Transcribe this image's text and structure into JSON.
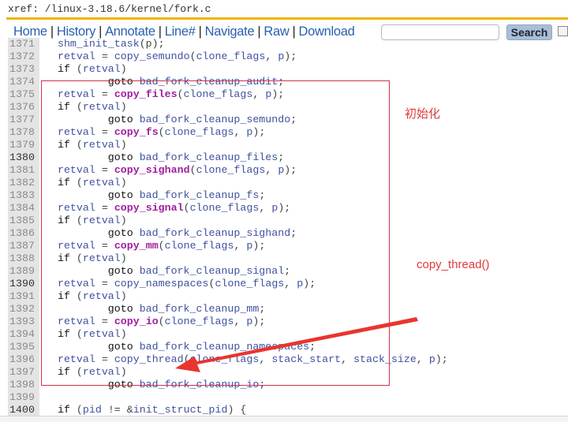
{
  "header": {
    "xref": "xref: /linux-3.18.6/kernel/fork.c"
  },
  "nav": {
    "items": [
      "Home",
      "History",
      "Annotate",
      "Line#",
      "Navigate",
      "Raw",
      "Download"
    ],
    "separator": "|",
    "search_value": "",
    "search_button": "Search"
  },
  "colors": {
    "accent": "#f0b400",
    "identifier": "#3f51a0",
    "function": "#a01fa0",
    "annotation": "#e03a3a"
  },
  "annotations": {
    "init_label": "初始化",
    "thread_label": "copy_thread()"
  },
  "code": [
    {
      "n": "1371",
      "p": [
        [
          "pn",
          "  "
        ],
        [
          "id",
          "shm_init_task"
        ],
        [
          "pn",
          "(p);"
        ]
      ]
    },
    {
      "n": "1372",
      "p": [
        [
          "pn",
          "  "
        ],
        [
          "id",
          "retval"
        ],
        [
          "pn",
          " = "
        ],
        [
          "id",
          "copy_semundo"
        ],
        [
          "pn",
          "("
        ],
        [
          "id",
          "clone_flags"
        ],
        [
          "pn",
          ", "
        ],
        [
          "id",
          "p"
        ],
        [
          "pn",
          ");"
        ]
      ]
    },
    {
      "n": "1373",
      "p": [
        [
          "kw",
          "  if "
        ],
        [
          "pn",
          "("
        ],
        [
          "id",
          "retval"
        ],
        [
          "pn",
          ")"
        ]
      ]
    },
    {
      "n": "1374",
      "p": [
        [
          "kw",
          "          goto "
        ],
        [
          "id",
          "bad_fork_cleanup_audit"
        ],
        [
          "pn",
          ";"
        ]
      ]
    },
    {
      "n": "1375",
      "p": [
        [
          "pn",
          "  "
        ],
        [
          "id",
          "retval"
        ],
        [
          "pn",
          " = "
        ],
        [
          "fn",
          "copy_files"
        ],
        [
          "pn",
          "("
        ],
        [
          "id",
          "clone_flags"
        ],
        [
          "pn",
          ", "
        ],
        [
          "id",
          "p"
        ],
        [
          "pn",
          ");"
        ]
      ]
    },
    {
      "n": "1376",
      "p": [
        [
          "kw",
          "  if "
        ],
        [
          "pn",
          "("
        ],
        [
          "id",
          "retval"
        ],
        [
          "pn",
          ")"
        ]
      ]
    },
    {
      "n": "1377",
      "p": [
        [
          "kw",
          "          goto "
        ],
        [
          "id",
          "bad_fork_cleanup_semundo"
        ],
        [
          "pn",
          ";"
        ]
      ]
    },
    {
      "n": "1378",
      "p": [
        [
          "pn",
          "  "
        ],
        [
          "id",
          "retval"
        ],
        [
          "pn",
          " = "
        ],
        [
          "fn",
          "copy_fs"
        ],
        [
          "pn",
          "("
        ],
        [
          "id",
          "clone_flags"
        ],
        [
          "pn",
          ", "
        ],
        [
          "id",
          "p"
        ],
        [
          "pn",
          ");"
        ]
      ]
    },
    {
      "n": "1379",
      "p": [
        [
          "kw",
          "  if "
        ],
        [
          "pn",
          "("
        ],
        [
          "id",
          "retval"
        ],
        [
          "pn",
          ")"
        ]
      ]
    },
    {
      "n": "1380",
      "p": [
        [
          "kw",
          "          goto "
        ],
        [
          "id",
          "bad_fork_cleanup_files"
        ],
        [
          "pn",
          ";"
        ]
      ]
    },
    {
      "n": "1381",
      "p": [
        [
          "pn",
          "  "
        ],
        [
          "id",
          "retval"
        ],
        [
          "pn",
          " = "
        ],
        [
          "fn",
          "copy_sighand"
        ],
        [
          "pn",
          "("
        ],
        [
          "id",
          "clone_flags"
        ],
        [
          "pn",
          ", "
        ],
        [
          "id",
          "p"
        ],
        [
          "pn",
          ");"
        ]
      ]
    },
    {
      "n": "1382",
      "p": [
        [
          "kw",
          "  if "
        ],
        [
          "pn",
          "("
        ],
        [
          "id",
          "retval"
        ],
        [
          "pn",
          ")"
        ]
      ]
    },
    {
      "n": "1383",
      "p": [
        [
          "kw",
          "          goto "
        ],
        [
          "id",
          "bad_fork_cleanup_fs"
        ],
        [
          "pn",
          ";"
        ]
      ]
    },
    {
      "n": "1384",
      "p": [
        [
          "pn",
          "  "
        ],
        [
          "id",
          "retval"
        ],
        [
          "pn",
          " = "
        ],
        [
          "fn",
          "copy_signal"
        ],
        [
          "pn",
          "("
        ],
        [
          "id",
          "clone_flags"
        ],
        [
          "pn",
          ", "
        ],
        [
          "id",
          "p"
        ],
        [
          "pn",
          ");"
        ]
      ]
    },
    {
      "n": "1385",
      "p": [
        [
          "kw",
          "  if "
        ],
        [
          "pn",
          "("
        ],
        [
          "id",
          "retval"
        ],
        [
          "pn",
          ")"
        ]
      ]
    },
    {
      "n": "1386",
      "p": [
        [
          "kw",
          "          goto "
        ],
        [
          "id",
          "bad_fork_cleanup_sighand"
        ],
        [
          "pn",
          ";"
        ]
      ]
    },
    {
      "n": "1387",
      "p": [
        [
          "pn",
          "  "
        ],
        [
          "id",
          "retval"
        ],
        [
          "pn",
          " = "
        ],
        [
          "fn",
          "copy_mm"
        ],
        [
          "pn",
          "("
        ],
        [
          "id",
          "clone_flags"
        ],
        [
          "pn",
          ", "
        ],
        [
          "id",
          "p"
        ],
        [
          "pn",
          ");"
        ]
      ]
    },
    {
      "n": "1388",
      "p": [
        [
          "kw",
          "  if "
        ],
        [
          "pn",
          "("
        ],
        [
          "id",
          "retval"
        ],
        [
          "pn",
          ")"
        ]
      ]
    },
    {
      "n": "1389",
      "p": [
        [
          "kw",
          "          goto "
        ],
        [
          "id",
          "bad_fork_cleanup_signal"
        ],
        [
          "pn",
          ";"
        ]
      ]
    },
    {
      "n": "1390",
      "p": [
        [
          "pn",
          "  "
        ],
        [
          "id",
          "retval"
        ],
        [
          "pn",
          " = "
        ],
        [
          "id",
          "copy_namespaces"
        ],
        [
          "pn",
          "("
        ],
        [
          "id",
          "clone_flags"
        ],
        [
          "pn",
          ", "
        ],
        [
          "id",
          "p"
        ],
        [
          "pn",
          ");"
        ]
      ]
    },
    {
      "n": "1391",
      "p": [
        [
          "kw",
          "  if "
        ],
        [
          "pn",
          "("
        ],
        [
          "id",
          "retval"
        ],
        [
          "pn",
          ")"
        ]
      ]
    },
    {
      "n": "1392",
      "p": [
        [
          "kw",
          "          goto "
        ],
        [
          "id",
          "bad_fork_cleanup_mm"
        ],
        [
          "pn",
          ";"
        ]
      ]
    },
    {
      "n": "1393",
      "p": [
        [
          "pn",
          "  "
        ],
        [
          "id",
          "retval"
        ],
        [
          "pn",
          " = "
        ],
        [
          "fn",
          "copy_io"
        ],
        [
          "pn",
          "("
        ],
        [
          "id",
          "clone_flags"
        ],
        [
          "pn",
          ", "
        ],
        [
          "id",
          "p"
        ],
        [
          "pn",
          ");"
        ]
      ]
    },
    {
      "n": "1394",
      "p": [
        [
          "kw",
          "  if "
        ],
        [
          "pn",
          "("
        ],
        [
          "id",
          "retval"
        ],
        [
          "pn",
          ")"
        ]
      ]
    },
    {
      "n": "1395",
      "p": [
        [
          "kw",
          "          goto "
        ],
        [
          "id",
          "bad_fork_cleanup_namespaces"
        ],
        [
          "pn",
          ";"
        ]
      ]
    },
    {
      "n": "1396",
      "p": [
        [
          "pn",
          "  "
        ],
        [
          "id",
          "retval"
        ],
        [
          "pn",
          " = "
        ],
        [
          "id",
          "copy_thread"
        ],
        [
          "pn",
          "("
        ],
        [
          "id",
          "clone_flags"
        ],
        [
          "pn",
          ", "
        ],
        [
          "id",
          "stack_start"
        ],
        [
          "pn",
          ", "
        ],
        [
          "id",
          "stack_size"
        ],
        [
          "pn",
          ", "
        ],
        [
          "id",
          "p"
        ],
        [
          "pn",
          ");"
        ]
      ]
    },
    {
      "n": "1397",
      "p": [
        [
          "kw",
          "  if "
        ],
        [
          "pn",
          "("
        ],
        [
          "id",
          "retval"
        ],
        [
          "pn",
          ")"
        ]
      ]
    },
    {
      "n": "1398",
      "p": [
        [
          "kw",
          "          goto "
        ],
        [
          "id",
          "bad_fork_cleanup_io"
        ],
        [
          "pn",
          ";"
        ]
      ]
    },
    {
      "n": "1399",
      "p": []
    },
    {
      "n": "1400",
      "p": [
        [
          "kw",
          "  if "
        ],
        [
          "pn",
          "("
        ],
        [
          "id",
          "pid"
        ],
        [
          "pn",
          " != &"
        ],
        [
          "id",
          "init_struct_pid"
        ],
        [
          "pn",
          ") {"
        ]
      ]
    }
  ]
}
